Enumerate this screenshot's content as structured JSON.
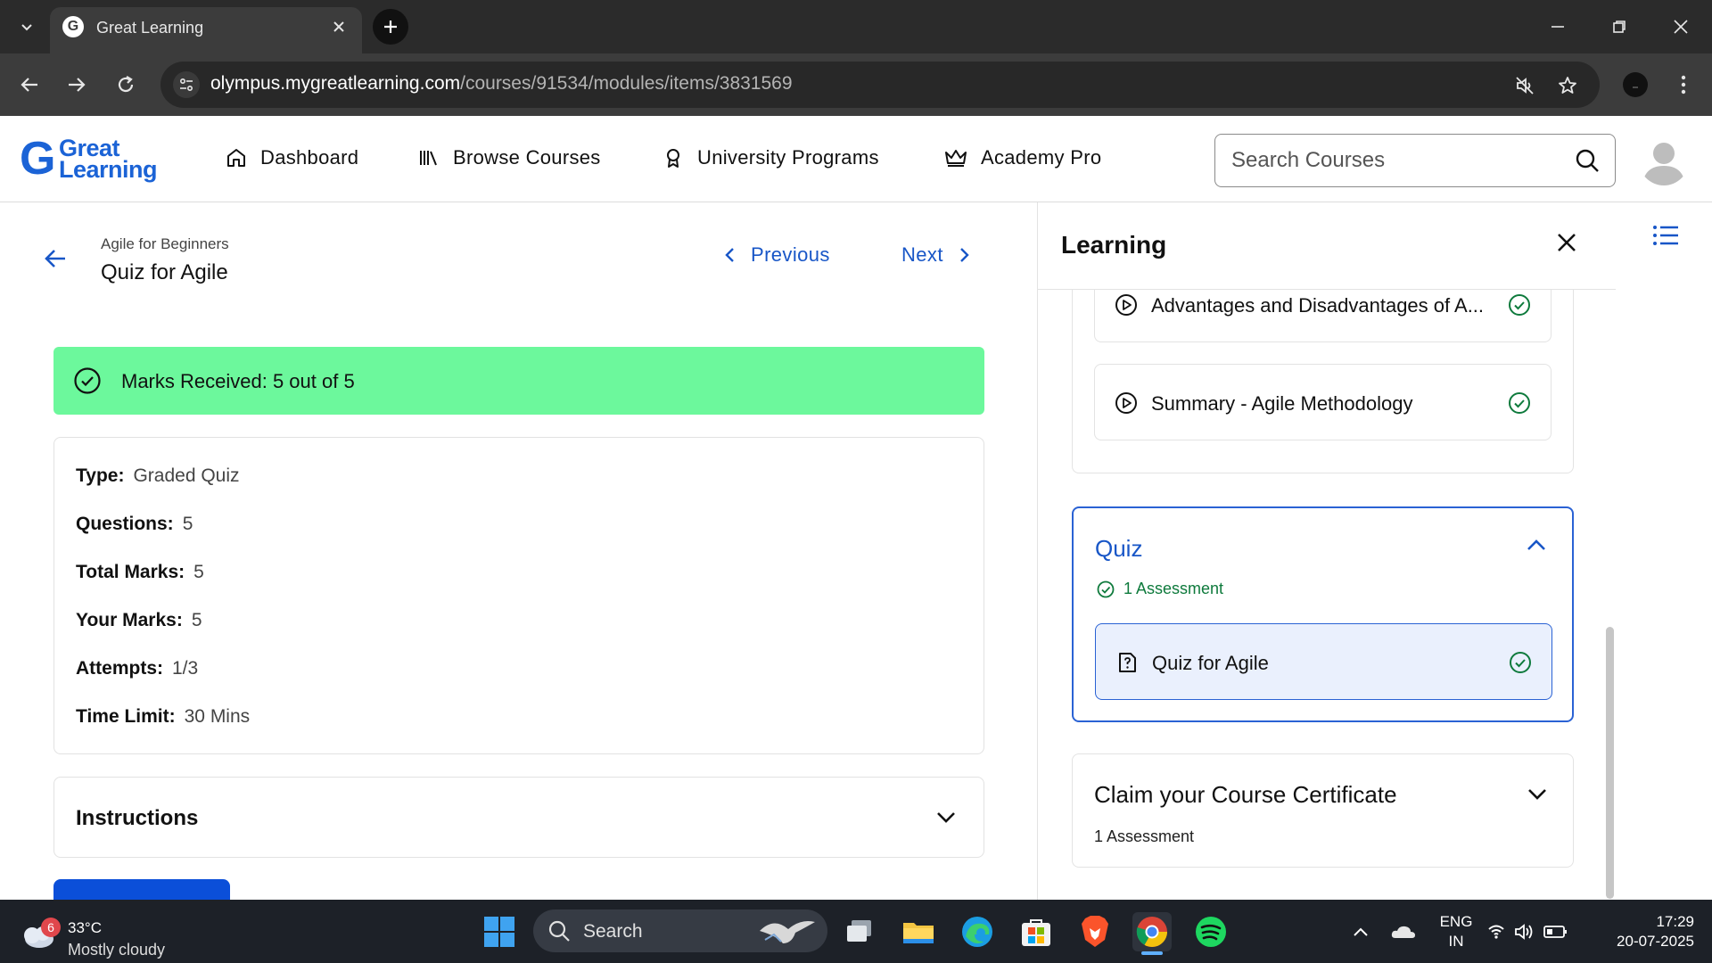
{
  "browser": {
    "tab_title": "Great Learning",
    "url_host": "olympus.mygreatlearning.com",
    "url_path": "/courses/91534/modules/items/3831569"
  },
  "header": {
    "logo_top": "Great",
    "logo_bottom": "Learning",
    "nav": [
      {
        "label": "Dashboard",
        "icon": "home-icon"
      },
      {
        "label": "Browse Courses",
        "icon": "library-icon"
      },
      {
        "label": "University Programs",
        "icon": "award-icon"
      },
      {
        "label": "Academy Pro",
        "icon": "crown-icon"
      }
    ],
    "search_placeholder": "Search Courses"
  },
  "main": {
    "breadcrumb": "Agile for Beginners",
    "title": "Quiz for Agile",
    "prev_label": "Previous",
    "next_label": "Next",
    "marks_banner": "Marks Received: 5 out of 5",
    "info": [
      {
        "key": "Type:",
        "value": "Graded Quiz"
      },
      {
        "key": "Questions:",
        "value": "5"
      },
      {
        "key": "Total Marks:",
        "value": "5"
      },
      {
        "key": "Your Marks:",
        "value": "5"
      },
      {
        "key": "Attempts:",
        "value": "1/3"
      },
      {
        "key": "Time Limit:",
        "value": "30 Mins"
      }
    ],
    "instructions_label": "Instructions"
  },
  "panel": {
    "title": "Learning",
    "prev_items": [
      {
        "label": "Advantages and Disadvantages of A...",
        "icon": "play-circle-icon",
        "done": true
      },
      {
        "label": "Summary - Agile Methodology",
        "icon": "play-circle-icon",
        "done": true
      }
    ],
    "quiz_section": {
      "title": "Quiz",
      "assessment_count": "1 Assessment",
      "item_label": "Quiz for Agile"
    },
    "certificate_section": {
      "title": "Claim your Course Certificate",
      "assessment_count": "1 Assessment"
    }
  },
  "taskbar": {
    "weather_badge": "6",
    "weather_temp": "33°C",
    "weather_desc": "Mostly cloudy",
    "search_label": "Search",
    "lang_top": "ENG",
    "lang_bottom": "IN",
    "time": "17:29",
    "date": "20-07-2025"
  },
  "colors": {
    "accent": "#1856c7",
    "success_banner": "#6cf89c",
    "success_text": "#0e7a3c"
  }
}
